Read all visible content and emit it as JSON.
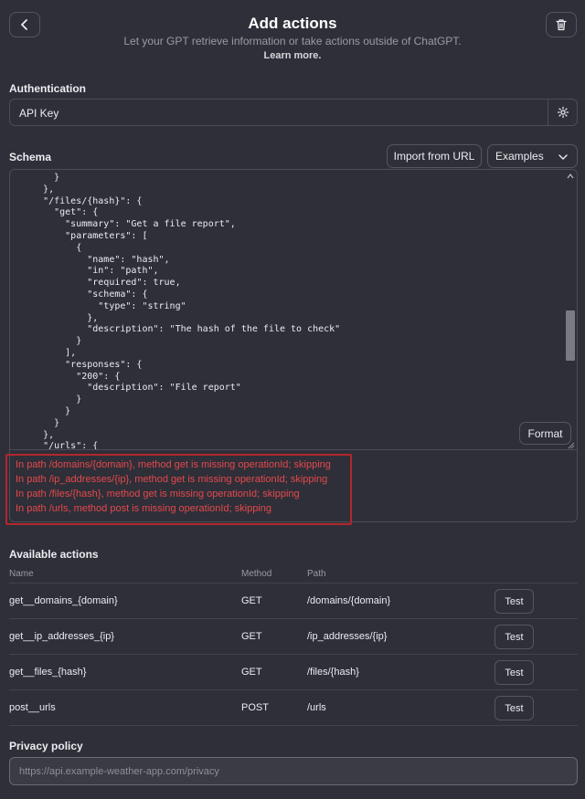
{
  "header": {
    "title": "Add actions",
    "subtitle": "Let your GPT retrieve information or take actions outside of ChatGPT.",
    "learn_more": "Learn more."
  },
  "authentication": {
    "label": "Authentication",
    "value": "API Key"
  },
  "schema": {
    "label": "Schema",
    "import_button": "Import from URL",
    "examples_select": "Examples",
    "format_button": "Format",
    "code": "      }\n    },\n    \"/files/{hash}\": {\n      \"get\": {\n        \"summary\": \"Get a file report\",\n        \"parameters\": [\n          {\n            \"name\": \"hash\",\n            \"in\": \"path\",\n            \"required\": true,\n            \"schema\": {\n              \"type\": \"string\"\n            },\n            \"description\": \"The hash of the file to check\"\n          }\n        ],\n        \"responses\": {\n          \"200\": {\n            \"description\": \"File report\"\n          }\n        }\n      }\n    },\n    \"/urls\": {",
    "errors": [
      "In path /domains/{domain}, method get is missing operationId; skipping",
      "In path /ip_addresses/{ip}, method get is missing operationId; skipping",
      "In path /files/{hash}, method get is missing operationId; skipping",
      "In path /urls, method post is missing operationId; skipping"
    ]
  },
  "actions": {
    "label": "Available actions",
    "columns": [
      "Name",
      "Method",
      "Path"
    ],
    "test_label": "Test",
    "rows": [
      {
        "name": "get__domains_{domain}",
        "method": "GET",
        "path": "/domains/{domain}"
      },
      {
        "name": "get__ip_addresses_{ip}",
        "method": "GET",
        "path": "/ip_addresses/{ip}"
      },
      {
        "name": "get__files_{hash}",
        "method": "GET",
        "path": "/files/{hash}"
      },
      {
        "name": "post__urls",
        "method": "POST",
        "path": "/urls"
      }
    ]
  },
  "privacy": {
    "label": "Privacy policy",
    "placeholder": "https://api.example-weather-app.com/privacy"
  },
  "icons": {
    "back": "chevron-left-icon",
    "delete": "trash-icon",
    "settings": "gear-icon",
    "dropdown": "chevron-down-icon"
  },
  "colors": {
    "background": "#2e2f38",
    "error_text": "#e5484d",
    "error_border": "#b3262d"
  }
}
